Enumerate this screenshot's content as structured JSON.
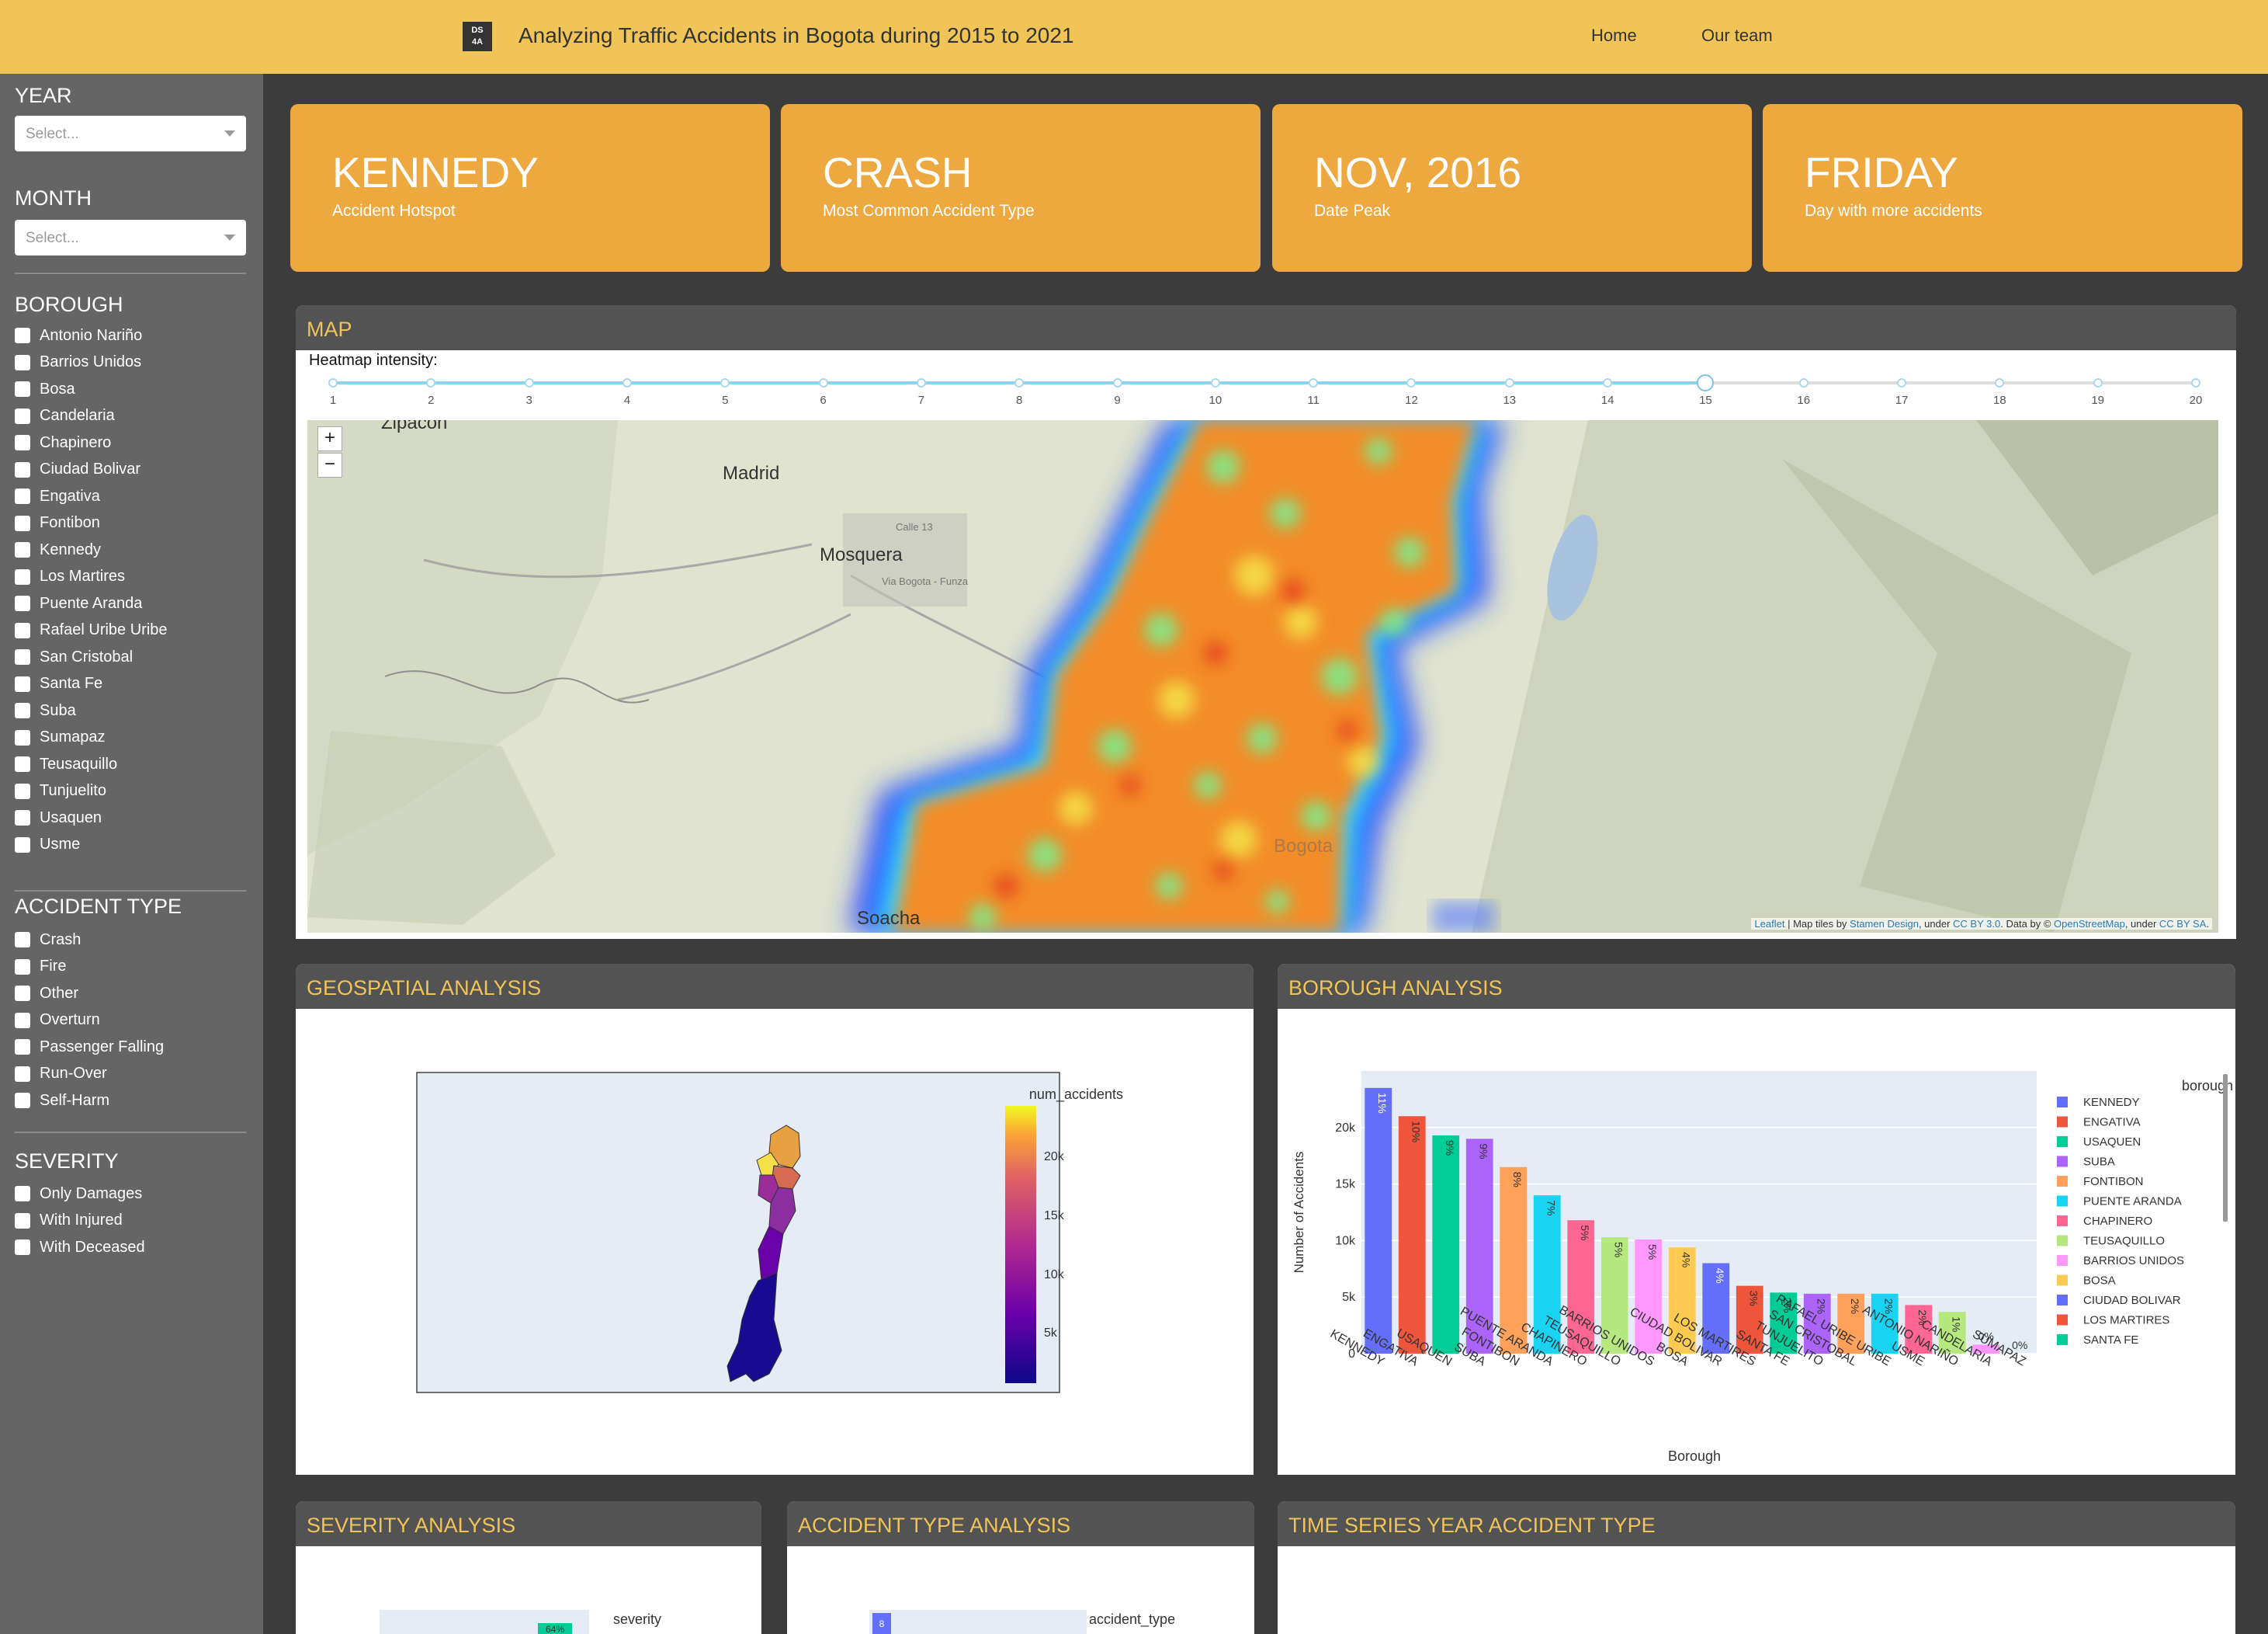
{
  "header": {
    "logo_text": "DS\n4A",
    "title": "Analyzing Traffic Accidents in Bogota during 2015 to 2021",
    "nav": [
      "Home",
      "Our team"
    ]
  },
  "sidebar": {
    "year_label": "YEAR",
    "year_placeholder": "Select...",
    "month_label": "MONTH",
    "month_placeholder": "Select...",
    "borough_label": "BOROUGH",
    "boroughs": [
      "Antonio Nariño",
      "Barrios Unidos",
      "Bosa",
      "Candelaria",
      "Chapinero",
      "Ciudad Bolivar",
      "Engativa",
      "Fontibon",
      "Kennedy",
      "Los Martires",
      "Puente Aranda",
      "Rafael Uribe Uribe",
      "San Cristobal",
      "Santa Fe",
      "Suba",
      "Sumapaz",
      "Teusaquillo",
      "Tunjuelito",
      "Usaquen",
      "Usme"
    ],
    "accident_type_label": "ACCIDENT TYPE",
    "accident_types": [
      "Crash",
      "Fire",
      "Other",
      "Overturn",
      "Passenger Falling",
      "Run-Over",
      "Self-Harm"
    ],
    "severity_label": "SEVERITY",
    "severities": [
      "Only Damages",
      "With Injured",
      "With Deceased"
    ]
  },
  "kpis": [
    {
      "value": "KENNEDY",
      "label": "Accident Hotspot"
    },
    {
      "value": "CRASH",
      "label": "Most Common Accident Type"
    },
    {
      "value": "NOV, 2016",
      "label": "Date Peak"
    },
    {
      "value": "FRIDAY",
      "label": "Day with more accidents"
    }
  ],
  "map_panel": {
    "title": "MAP",
    "heatmap_label": "Heatmap intensity:",
    "slider_ticks": [
      "1",
      "2",
      "3",
      "4",
      "5",
      "6",
      "7",
      "8",
      "9",
      "10",
      "11",
      "12",
      "13",
      "14",
      "15",
      "16",
      "17",
      "18",
      "19",
      "20"
    ],
    "slider_value": 15,
    "zoom_in": "+",
    "zoom_out": "−",
    "places": [
      "Zipacon",
      "Madrid",
      "Mosquera",
      "Bogota",
      "Soacha",
      "Calle 13",
      "Via Bogota - Funza"
    ],
    "attribution": {
      "leaflet": "Leaflet",
      "t1": " | Map tiles by ",
      "stamen": "Stamen Design",
      "t2": ", under ",
      "ccby": "CC BY 3.0",
      "t3": ". Data by © ",
      "osm": "OpenStreetMap",
      "t4": ", under ",
      "ccbysa": "CC BY SA",
      "t5": "."
    }
  },
  "geo_panel": {
    "title": "GEOSPATIAL ANALYSIS",
    "colorbar_title": "num_accidents",
    "colorbar_ticks": [
      "20k",
      "15k",
      "10k",
      "5k"
    ]
  },
  "borough_panel": {
    "title": "BOROUGH ANALYSIS"
  },
  "bottom_panels": {
    "severity_title": "SEVERITY ANALYSIS",
    "severity_legend": "severity",
    "severity_bar_label": "64%",
    "accident_type_title": "ACCIDENT TYPE ANALYSIS",
    "accident_type_legend": "accident_type",
    "accident_type_bar_label": "8",
    "timeseries_title": "TIME SERIES YEAR ACCIDENT TYPE"
  },
  "colors": {
    "header": "#f0c457",
    "sidebar": "#656565",
    "kpi": "#eda940",
    "panel_header": "#535353",
    "panel_title": "#f0c457"
  },
  "chart_data": {
    "type": "bar",
    "xlabel": "Borough",
    "ylabel": "Number of Accidents",
    "legend_title": "borough",
    "legend_position": "right",
    "ylim": [
      0,
      25000
    ],
    "yticks": [
      "0",
      "5k",
      "10k",
      "15k",
      "20k"
    ],
    "categories": [
      "KENNEDY",
      "ENGATIVA",
      "USAQUEN",
      "SUBA",
      "FONTIBON",
      "PUENTE ARANDA",
      "CHAPINERO",
      "TEUSAQUILLO",
      "BARRIOS UNIDOS",
      "BOSA",
      "CIUDAD BOLIVAR",
      "LOS MARTIRES",
      "SANTA FE",
      "TUNJUELITO",
      "SAN CRISTOBAL",
      "RAFAEL URIBE URIBE",
      "USME",
      "ANTONIO NARIÑO",
      "CANDELARIA",
      "SUMAPAZ"
    ],
    "values": [
      23500,
      21000,
      19300,
      19000,
      16500,
      14000,
      11800,
      10300,
      10100,
      9400,
      8000,
      6000,
      5400,
      5300,
      5300,
      5300,
      4300,
      3700,
      800,
      0
    ],
    "labels": [
      "11%",
      "10%",
      "9%",
      "9%",
      "8%",
      "7%",
      "5%",
      "5%",
      "5%",
      "4%",
      "4%",
      "3%",
      "2%",
      "2%",
      "2%",
      "2%",
      "2%",
      "1%",
      "0%",
      "0%"
    ],
    "colors": [
      "#636efa",
      "#EF553B",
      "#00cc96",
      "#ab63fa",
      "#FFA15A",
      "#19d3f3",
      "#FF6692",
      "#B6E880",
      "#FF97FF",
      "#FECB52",
      "#636efa",
      "#EF553B",
      "#00cc96",
      "#ab63fa",
      "#FFA15A",
      "#19d3f3",
      "#FF6692",
      "#B6E880",
      "#FF97FF",
      "#FECB52"
    ]
  }
}
